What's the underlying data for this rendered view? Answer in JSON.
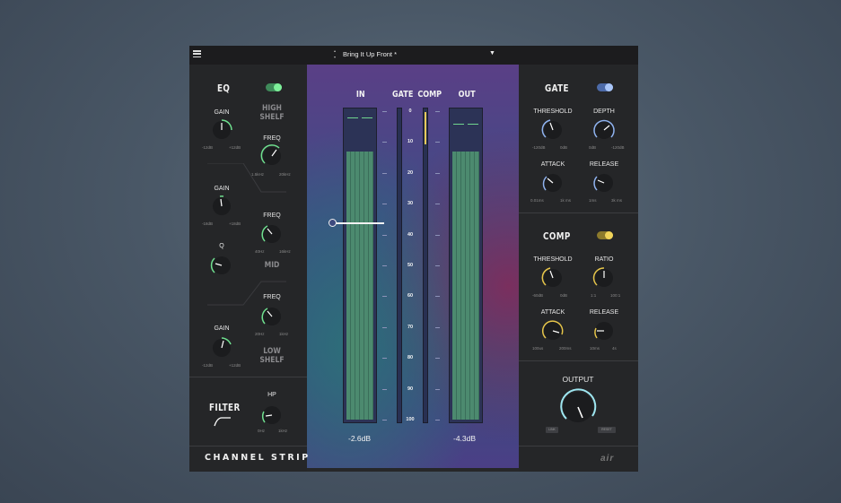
{
  "topbar": {
    "preset_name": "Bring It Up Front *",
    "arrows_up": "▲",
    "arrows_down": "▼",
    "dropdown": "▼"
  },
  "eq": {
    "title": "EQ",
    "high_shelf": {
      "label_line1": "HIGH",
      "label_line2": "SHELF",
      "gain_label": "GAIN",
      "gain_min": "-12dB",
      "gain_max": "+12dB",
      "freq_label": "FREQ",
      "freq_min": "1.5kHz",
      "freq_max": "20kHz"
    },
    "mid": {
      "label": "MID",
      "gain_label": "GAIN",
      "gain_min": "-18dB",
      "gain_max": "+18dB",
      "freq_label": "FREQ",
      "freq_min": "40Hz",
      "freq_max": "16kHz",
      "q_label": "Q"
    },
    "low_shelf": {
      "label_line1": "LOW",
      "label_line2": "SHELF",
      "gain_label": "GAIN",
      "gain_min": "-12dB",
      "gain_max": "+12dB",
      "freq_label": "FREQ",
      "freq_min": "20Hz",
      "freq_max": "1kHz"
    }
  },
  "filter": {
    "title": "FILTER",
    "hp_label": "HP",
    "hp_min": "0Hz",
    "hp_max": "1kHz"
  },
  "meters": {
    "in_title": "IN",
    "gate_title": "GATE",
    "comp_title": "COMP",
    "out_title": "OUT",
    "scale": [
      "0",
      "10",
      "20",
      "30",
      "40",
      "50",
      "60",
      "70",
      "80",
      "90",
      "100"
    ],
    "in_value": "-2.6dB",
    "out_value": "-4.3dB"
  },
  "gate": {
    "title": "GATE",
    "threshold_label": "THRESHOLD",
    "threshold_min": "-120dB",
    "threshold_max": "0dB",
    "depth_label": "DEPTH",
    "depth_min": "0dB",
    "depth_max": "-120dB",
    "attack_label": "ATTACK",
    "attack_min": "0.01ms",
    "attack_max": "1k ms",
    "release_label": "RELEASE",
    "release_min": "1ms",
    "release_max": "3k ms"
  },
  "comp": {
    "title": "COMP",
    "threshold_label": "THRESHOLD",
    "threshold_min": "-60dB",
    "threshold_max": "0dB",
    "ratio_label": "RATIO",
    "ratio_min": "1:1",
    "ratio_max": "100:1",
    "attack_label": "ATTACK",
    "attack_min": "100us",
    "attack_max": "200ms",
    "release_label": "RELEASE",
    "release_min": "10ms",
    "release_max": "4s"
  },
  "output": {
    "title": "OUTPUT",
    "btn_left": "LINK",
    "btn_right": "RESET"
  },
  "footer": {
    "title": "CHANNEL STRIP",
    "logo": "air"
  },
  "colors": {
    "eq_accent": "#6fe08f",
    "gate_accent": "#8fb3f0",
    "comp_accent": "#e6c54a",
    "output_accent": "#9ee6f0"
  }
}
